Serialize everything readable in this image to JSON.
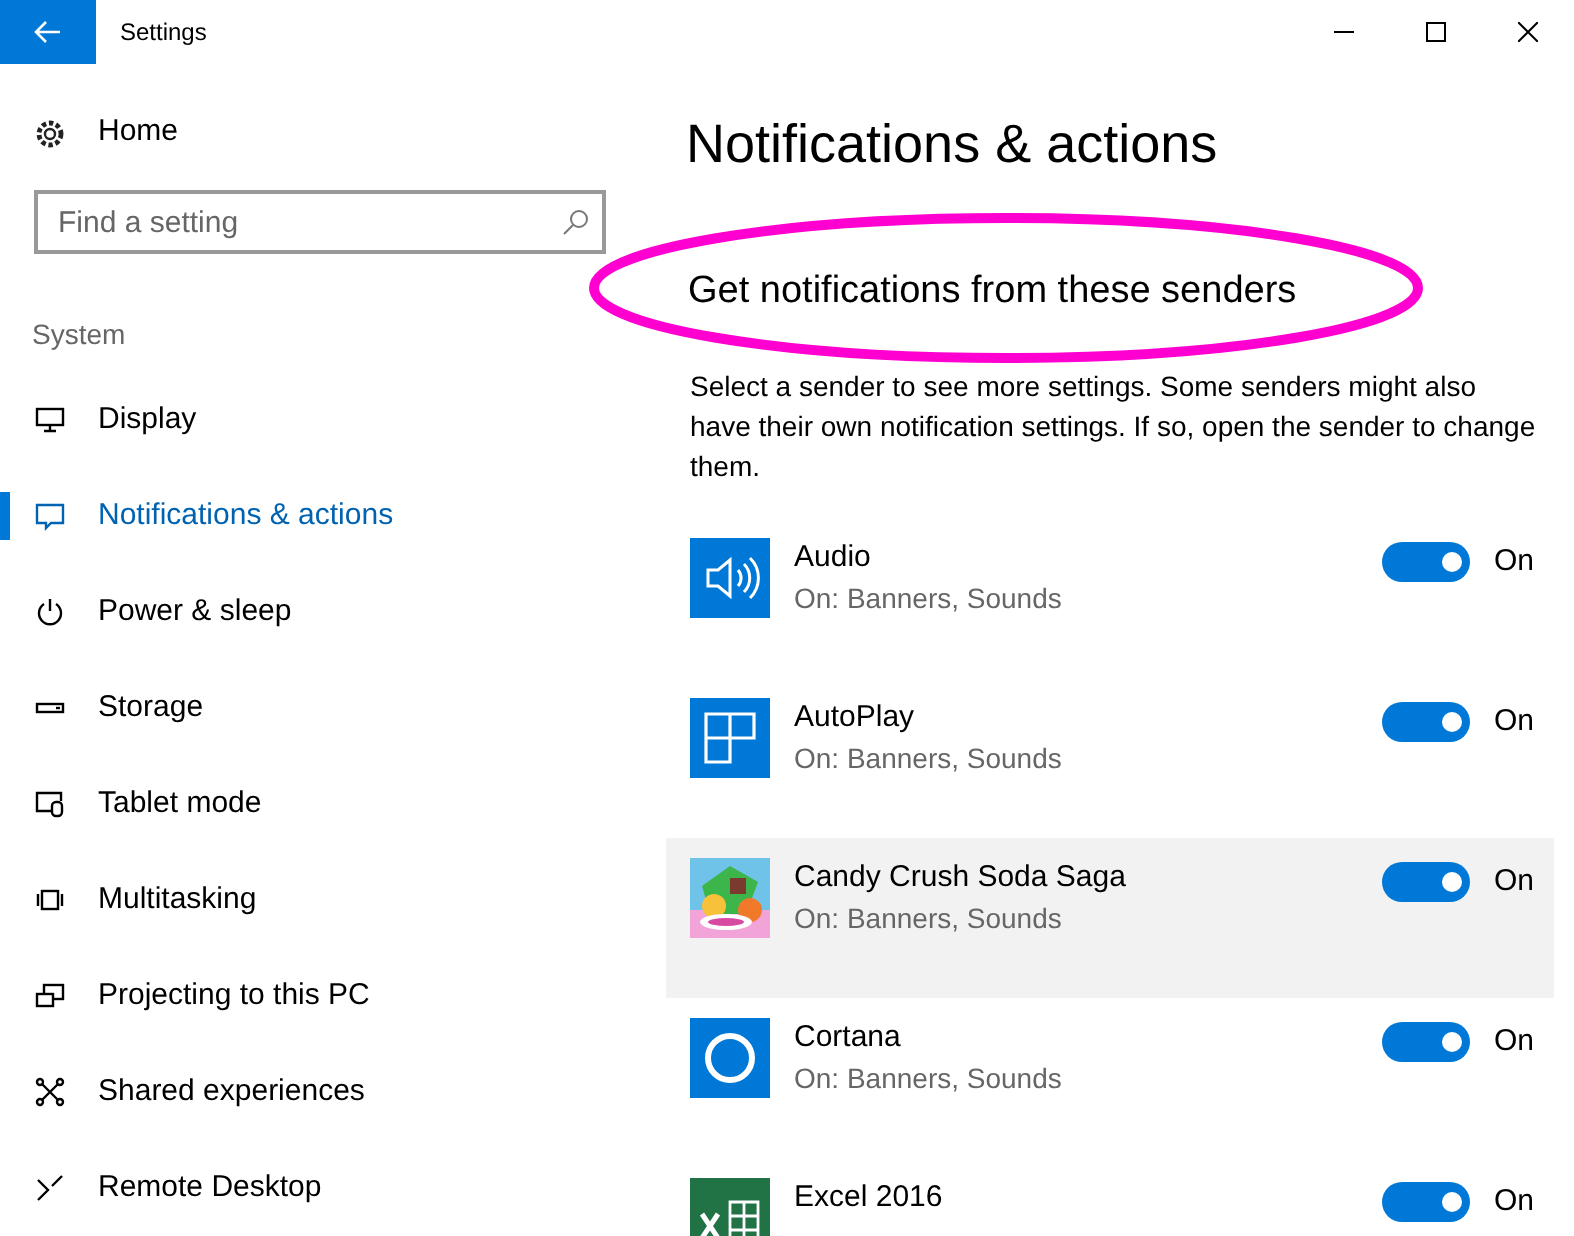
{
  "window": {
    "title": "Settings"
  },
  "sidebar": {
    "home": "Home",
    "search": {
      "placeholder": "Find a setting"
    },
    "section": "System",
    "items": [
      {
        "label": "Display",
        "kind": "display",
        "selected": false
      },
      {
        "label": "Notifications & actions",
        "kind": "notifications",
        "selected": true
      },
      {
        "label": "Power & sleep",
        "kind": "power",
        "selected": false
      },
      {
        "label": "Storage",
        "kind": "storage",
        "selected": false
      },
      {
        "label": "Tablet mode",
        "kind": "tablet",
        "selected": false
      },
      {
        "label": "Multitasking",
        "kind": "multitasking",
        "selected": false
      },
      {
        "label": "Projecting to this PC",
        "kind": "projecting",
        "selected": false
      },
      {
        "label": "Shared experiences",
        "kind": "shared",
        "selected": false
      },
      {
        "label": "Remote Desktop",
        "kind": "remote",
        "selected": false
      }
    ]
  },
  "page": {
    "title": "Notifications & actions",
    "subtitle": "Get notifications from these senders",
    "description": "Select a sender to see more settings. Some senders might also have their own notification settings. If so, open the sender to change them.",
    "senders": [
      {
        "name": "Audio",
        "detail": "On: Banners, Sounds",
        "kind": "audio",
        "highlighted": false,
        "on": true,
        "toggle_label": "On"
      },
      {
        "name": "AutoPlay",
        "detail": "On: Banners, Sounds",
        "kind": "autoplay",
        "highlighted": false,
        "on": true,
        "toggle_label": "On"
      },
      {
        "name": "Candy Crush Soda Saga",
        "detail": "On: Banners, Sounds",
        "kind": "game",
        "highlighted": true,
        "on": true,
        "toggle_label": "On"
      },
      {
        "name": "Cortana",
        "detail": "On: Banners, Sounds",
        "kind": "cortana",
        "highlighted": false,
        "on": true,
        "toggle_label": "On"
      },
      {
        "name": "Excel 2016",
        "kind": "excel",
        "highlighted": false,
        "on": true,
        "toggle_label": "On"
      }
    ]
  }
}
